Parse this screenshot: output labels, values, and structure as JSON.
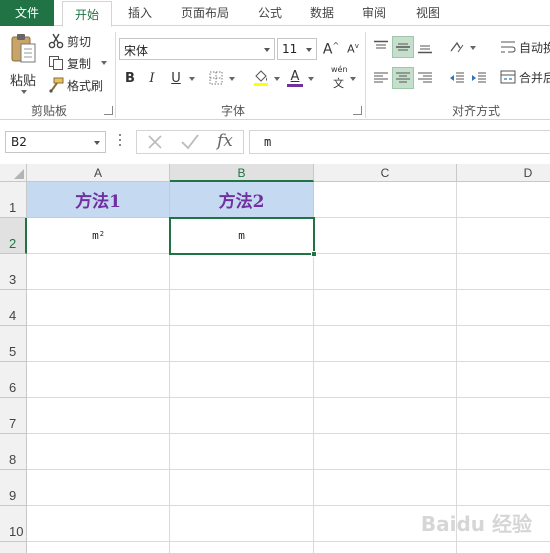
{
  "tabs": [
    "文件",
    "开始",
    "插入",
    "页面布局",
    "公式",
    "数据",
    "审阅",
    "视图"
  ],
  "active_tab": "开始",
  "clipboard": {
    "paste_label": "粘贴",
    "cut_label": "剪切",
    "copy_label": "复制",
    "format_painter_label": "格式刷",
    "group_label": "剪贴板"
  },
  "font": {
    "font_name": "宋体",
    "font_size": "11",
    "bold": "B",
    "italic": "I",
    "underline": "U",
    "font_color_letter": "A",
    "wen_label": "wén",
    "wen_char": "文",
    "group_label": "字体",
    "font_color": "#7030a0",
    "fill_color": "#ffff00"
  },
  "alignment": {
    "wrap_label": "自动换",
    "merge_label": "合并后",
    "group_label": "对齐方式"
  },
  "formula_bar": {
    "name_box": "B2",
    "fx_label": "fx",
    "content": "m"
  },
  "columns": [
    "A",
    "B",
    "C",
    "D"
  ],
  "rows": [
    "1",
    "2",
    "3",
    "4",
    "5",
    "6",
    "7",
    "8",
    "9",
    "10"
  ],
  "cells": {
    "A1": "方法1",
    "B1": "方法2",
    "A2_base": "m",
    "A2_sup": "2",
    "B2": "m"
  },
  "selected_cell": "B2",
  "watermark": "Baidu 经验",
  "colors": {
    "accent": "#217346",
    "header_fill": "#c5d9f1",
    "header_text": "#7030a0"
  }
}
